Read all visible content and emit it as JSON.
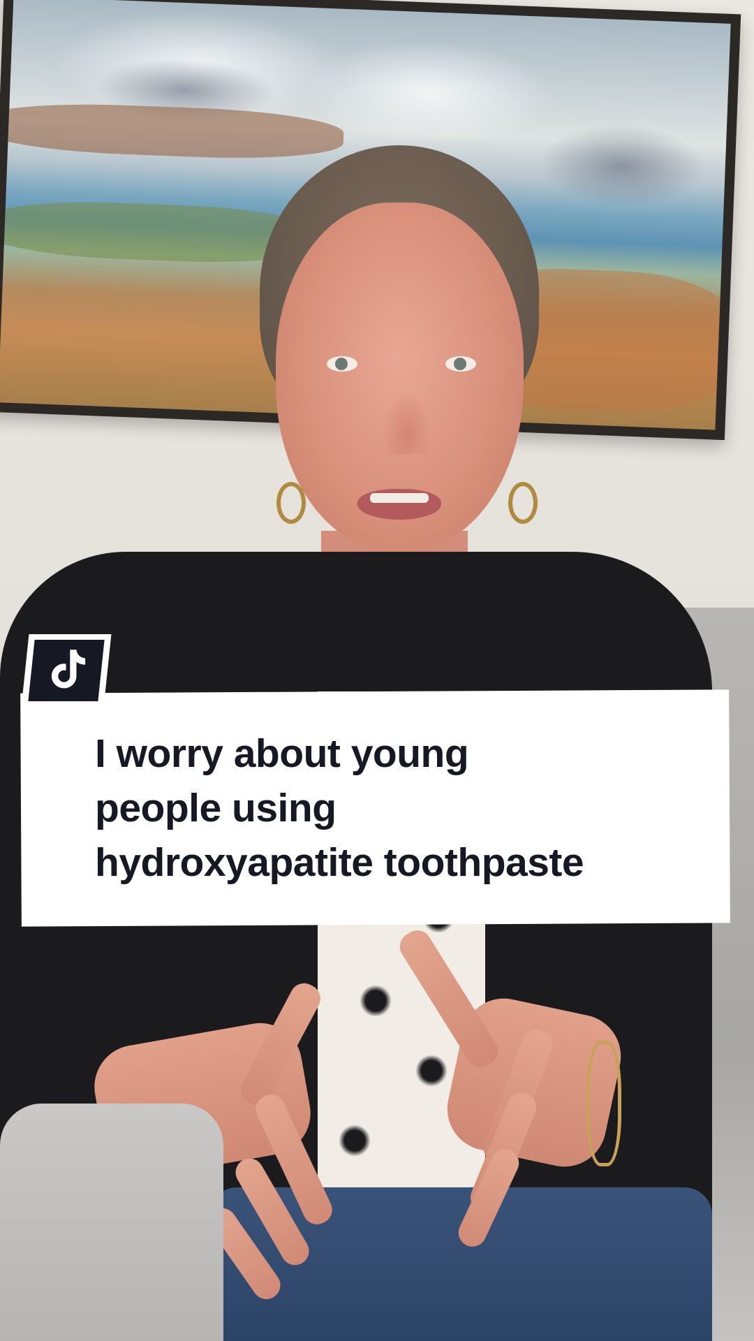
{
  "app": "TikTok",
  "caption": {
    "lines": [
      "I worry about young",
      "people using",
      "hydroxyapatite toothpaste"
    ]
  },
  "badge": {
    "icon": "tiktok-logo-icon"
  },
  "colors": {
    "caption_bg": "#ffffff",
    "caption_text": "#161823",
    "badge_bg": "#161823"
  }
}
